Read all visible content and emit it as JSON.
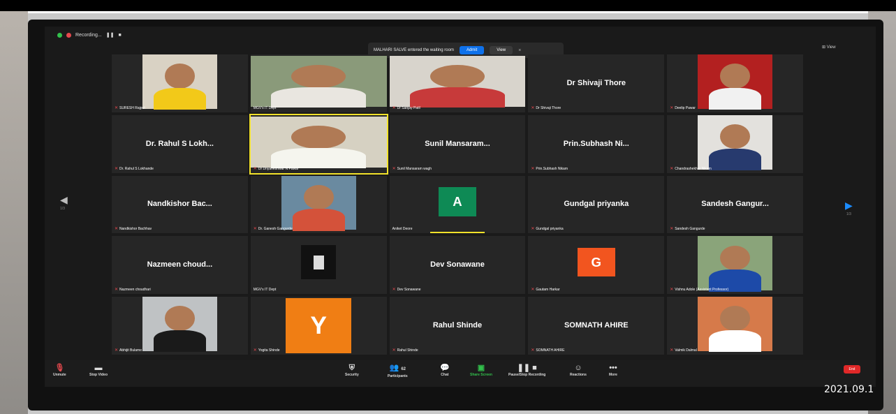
{
  "recording": {
    "label": "Recording..."
  },
  "notification": {
    "text": "MALHARI SALVE entered the waiting room",
    "admit": "Admit",
    "view": "View",
    "close": "×"
  },
  "view_button": "View",
  "nav": {
    "left_page": "1/3",
    "right_page": "1/3"
  },
  "tiles": [
    {
      "label": "SURESH Rajput",
      "display": "",
      "avatar": null
    },
    {
      "label": "MGV's IT Dept",
      "display": "",
      "avatar": null
    },
    {
      "label": "Dr Sanjay Patil",
      "display": "",
      "avatar": null
    },
    {
      "label": "Dr Shivaji Thore",
      "display": "Dr Shivaji Thore",
      "avatar": null
    },
    {
      "label": "Deelip Pawar",
      "display": "",
      "avatar": null
    },
    {
      "label": "Dr. Rahul S Lokhande",
      "display": "Dr. Rahul S Lokh...",
      "avatar": null
    },
    {
      "label": "Dr Dnyaneshwar N Pawar",
      "display": "",
      "avatar": null
    },
    {
      "label": "Sunil Mansaram wagh",
      "display": "Sunil Mansaram...",
      "avatar": null
    },
    {
      "label": "Prin.Subhash Nikam",
      "display": "Prin.Subhash Ni...",
      "avatar": null
    },
    {
      "label": "Chandrashekhar Nikam",
      "display": "",
      "avatar": null
    },
    {
      "label": "Nandkishor Bachhav",
      "display": "Nandkishor Bac...",
      "avatar": null
    },
    {
      "label": "Dr. Ganesh Gangurde",
      "display": "",
      "avatar": null
    },
    {
      "label": "Aniket Deore",
      "display": "",
      "avatar": "A"
    },
    {
      "label": "Gundgal priyanka",
      "display": "Gundgal priyanka",
      "avatar": null
    },
    {
      "label": "Sandesh Gangurde",
      "display": "Sandesh Gangur...",
      "avatar": null
    },
    {
      "label": "Nazmeen choudhari",
      "display": "Nazmeen choud...",
      "avatar": null
    },
    {
      "label": "MGV's IT Dept",
      "display": "",
      "avatar": null
    },
    {
      "label": "Dev Sonawane",
      "display": "Dev Sonawane",
      "avatar": null
    },
    {
      "label": "Gautam Harkar",
      "display": "",
      "avatar": "G"
    },
    {
      "label": "Vishnu Adole (Assistant Professor)",
      "display": "",
      "avatar": null
    },
    {
      "label": "Abhijit Bulame",
      "display": "",
      "avatar": null
    },
    {
      "label": "Yogita Shinde",
      "display": "",
      "avatar": "Y"
    },
    {
      "label": "Rahul Shinde",
      "display": "Rahul Shinde",
      "avatar": null
    },
    {
      "label": "SOMNATH AHIRE",
      "display": "SOMNATH AHIRE",
      "avatar": null
    },
    {
      "label": "Valmik Dalmal",
      "display": "",
      "avatar": null
    }
  ],
  "toolbar": {
    "unmute": "Unmute",
    "stop_video": "Stop Video",
    "security": "Security",
    "participants": "Participants",
    "participants_count": "62",
    "chat": "Chat",
    "share_screen": "Share Screen",
    "recording": "Pause/Stop Recording",
    "reactions": "Reactions",
    "more": "More",
    "end": "End"
  },
  "timestamp": "2021.09.1",
  "colors": {
    "avatar_A": "#0e8a55",
    "avatar_G": "#f2551f",
    "avatar_Y": "#f07e14",
    "share_green": "#32c04c",
    "end_red": "#e02828"
  }
}
